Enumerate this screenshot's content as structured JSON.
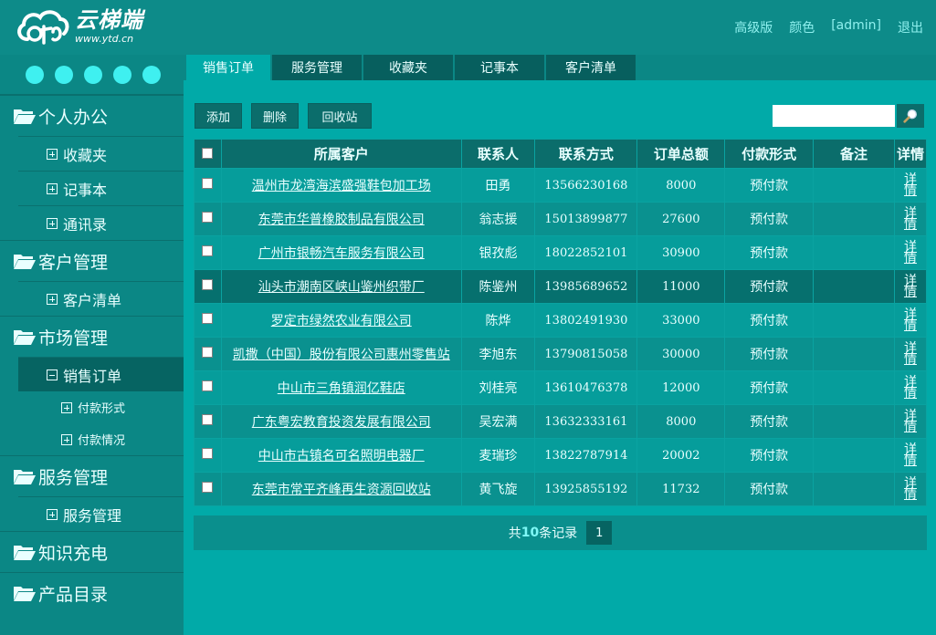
{
  "header": {
    "logo_title": "云梯端",
    "logo_url": "www.ytd.cn",
    "links": [
      "高级版",
      "颜色",
      "[admin]",
      "退出"
    ]
  },
  "sidebar": {
    "groups": [
      {
        "label": "个人办公",
        "items": [
          "收藏夹",
          "记事本",
          "通讯录"
        ]
      },
      {
        "label": "客户管理",
        "items": [
          "客户清单"
        ]
      },
      {
        "label": "市场管理",
        "items": [
          "销售订单"
        ],
        "subitems": [
          "付款形式",
          "付款情况"
        ]
      },
      {
        "label": "服务管理",
        "items": [
          "服务管理"
        ]
      },
      {
        "label": "知识充电"
      },
      {
        "label": "产品目录"
      }
    ]
  },
  "tabs": [
    "销售订单",
    "服务管理",
    "收藏夹",
    "记事本",
    "客户清单"
  ],
  "toolbar": {
    "add": "添加",
    "delete": "删除",
    "recycle": "回收站"
  },
  "search": {
    "placeholder": ""
  },
  "table": {
    "headers": [
      "所属客户",
      "联系人",
      "联系方式",
      "订单总额",
      "付款形式",
      "备注",
      "详情"
    ],
    "rows": [
      {
        "customer": "温州市龙湾海滨盛强鞋包加工场",
        "contact": "田勇",
        "phone": "13566230168",
        "amount": "8000",
        "payment": "预付款",
        "note": "",
        "detail": "详情"
      },
      {
        "customer": "东莞市华普橡胶制品有限公司",
        "contact": "翁志援",
        "phone": "15013899877",
        "amount": "27600",
        "payment": "预付款",
        "note": "",
        "detail": "详情"
      },
      {
        "customer": "广州市银畅汽车服务有限公司",
        "contact": "银孜彪",
        "phone": "18022852101",
        "amount": "30900",
        "payment": "预付款",
        "note": "",
        "detail": "详情"
      },
      {
        "customer": "汕头市潮南区峡山鉴州织带厂",
        "contact": "陈鉴州",
        "phone": "13985689652",
        "amount": "11000",
        "payment": "预付款",
        "note": "",
        "detail": "详情"
      },
      {
        "customer": "罗定市绿然农业有限公司",
        "contact": "陈烨",
        "phone": "13802491930",
        "amount": "33000",
        "payment": "预付款",
        "note": "",
        "detail": "详情"
      },
      {
        "customer": "凯撒（中国）股份有限公司惠州零售站",
        "contact": "李旭东",
        "phone": "13790815058",
        "amount": "30000",
        "payment": "预付款",
        "note": "",
        "detail": "详情"
      },
      {
        "customer": "中山市三角镇润亿鞋店",
        "contact": "刘桂亮",
        "phone": "13610476378",
        "amount": "12000",
        "payment": "预付款",
        "note": "",
        "detail": "详情"
      },
      {
        "customer": "广东粤宏教育投资发展有限公司",
        "contact": "吴宏满",
        "phone": "13632333161",
        "amount": "8000",
        "payment": "预付款",
        "note": "",
        "detail": "详情"
      },
      {
        "customer": "中山市古镇名可名照明电器厂",
        "contact": "麦瑞珍",
        "phone": "13822787914",
        "amount": "20002",
        "payment": "预付款",
        "note": "",
        "detail": "详情"
      },
      {
        "customer": "东莞市常平齐峰再生资源回收站",
        "contact": "黄飞旋",
        "phone": "13925855192",
        "amount": "11732",
        "payment": "预付款",
        "note": "",
        "detail": "详情"
      }
    ]
  },
  "pager": {
    "prefix": "共",
    "count": "10",
    "suffix": "条记录",
    "page": "1"
  },
  "colors": {
    "accent": "#01aaa8",
    "sidebar": "#0b8785",
    "dark": "#066462",
    "dot": "#3ff0f0"
  }
}
